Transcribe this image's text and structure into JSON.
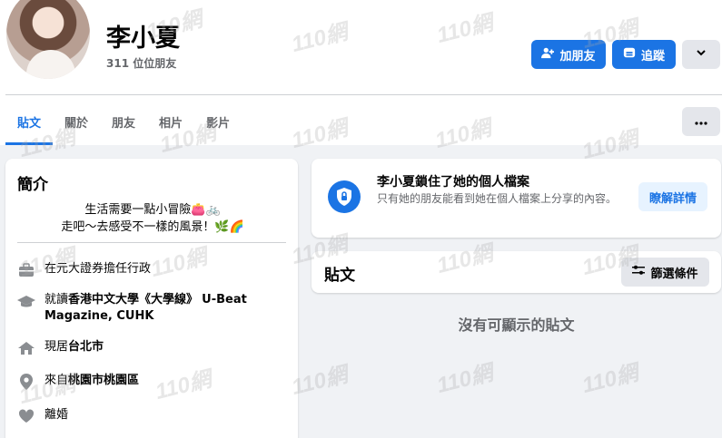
{
  "profile": {
    "name": "李小夏",
    "friends_count": "311 位位朋友"
  },
  "actions": {
    "add_friend": "加朋友",
    "follow": "追蹤",
    "more_icon": "chevron-down-icon"
  },
  "tabs": [
    {
      "label": "貼文",
      "active": true
    },
    {
      "label": "關於",
      "active": false
    },
    {
      "label": "朋友",
      "active": false
    },
    {
      "label": "相片",
      "active": false
    },
    {
      "label": "影片",
      "active": false
    }
  ],
  "intro": {
    "title": "簡介",
    "bio_line1": "生活需要一點小冒險👛🚲",
    "bio_line2": "走吧～去感受不一樣的風景！🌿🌈",
    "work": {
      "text": "在元大證券擔任行政",
      "icon": "briefcase-icon"
    },
    "education": {
      "prefix": "就讀",
      "school": "香港中文大學《大學線》",
      "suffix": "U-Beat Magazine, CUHK",
      "icon": "graduation-cap-icon"
    },
    "lives": {
      "prefix": "現居",
      "place": "台北市",
      "icon": "home-icon"
    },
    "from": {
      "prefix": "來自",
      "place": "桃園市桃園區",
      "icon": "location-pin-icon"
    },
    "relationship": {
      "text": "離婚",
      "icon": "heart-icon"
    }
  },
  "locked": {
    "title": "李小夏鎖住了她的個人檔案",
    "description": "只有她的朋友能看到她在個人檔案上分享的內容。",
    "learn_more": "瞭解詳情"
  },
  "posts": {
    "title": "貼文",
    "filter": "篩選條件",
    "empty": "沒有可顯示的貼文"
  },
  "watermark": "110網",
  "colors": {
    "accent": "#1b74e4",
    "background": "#f0f2f5",
    "secondary_text": "#65676b"
  }
}
